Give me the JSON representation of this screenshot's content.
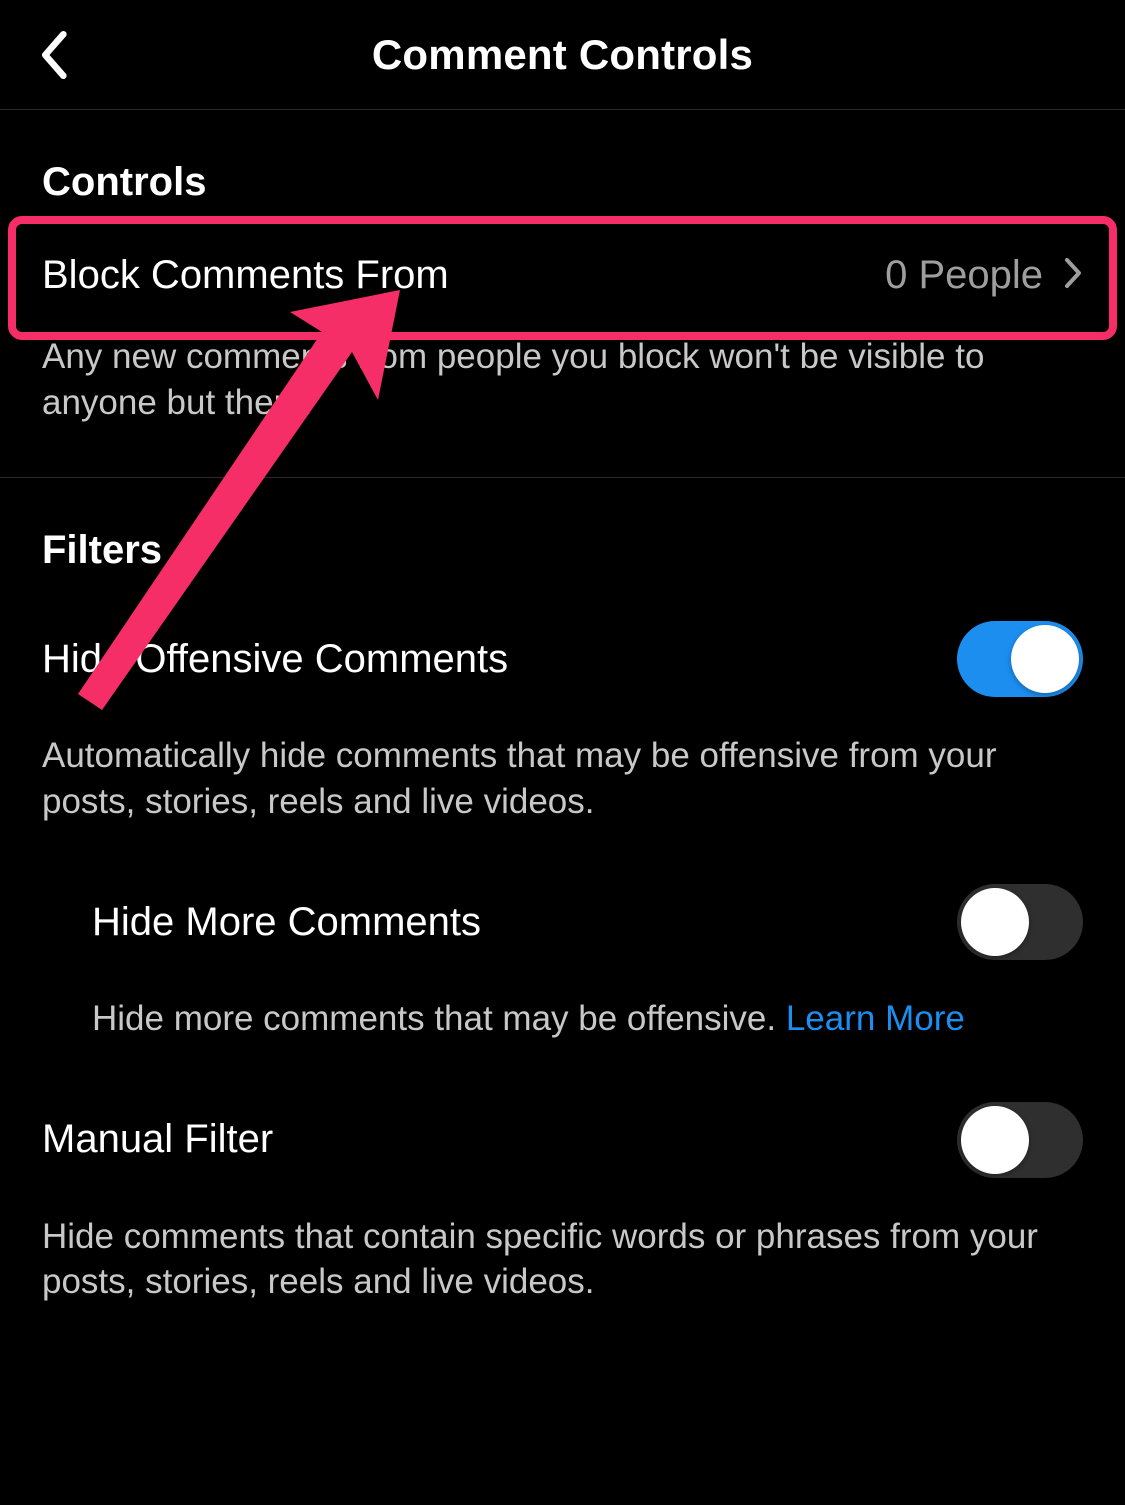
{
  "header": {
    "title": "Comment Controls"
  },
  "sections": {
    "controls": {
      "heading": "Controls",
      "block_comments": {
        "label": "Block Comments From",
        "value": "0 People",
        "description": "Any new comments from people you block won't be visible to anyone but them."
      }
    },
    "filters": {
      "heading": "Filters",
      "hide_offensive": {
        "label": "Hide Offensive Comments",
        "description": "Automatically hide comments that may be offensive from your posts, stories, reels and live videos.",
        "on": true
      },
      "hide_more": {
        "label": "Hide More Comments",
        "description": "Hide more comments that may be offensive. ",
        "learn_more": "Learn More",
        "on": false
      },
      "manual_filter": {
        "label": "Manual Filter",
        "description": "Hide comments that contain specific words or phrases from your posts, stories, reels and live videos.",
        "on": false
      }
    }
  },
  "colors": {
    "accent": "#1c8ef0",
    "annotation": "#f62e68"
  }
}
